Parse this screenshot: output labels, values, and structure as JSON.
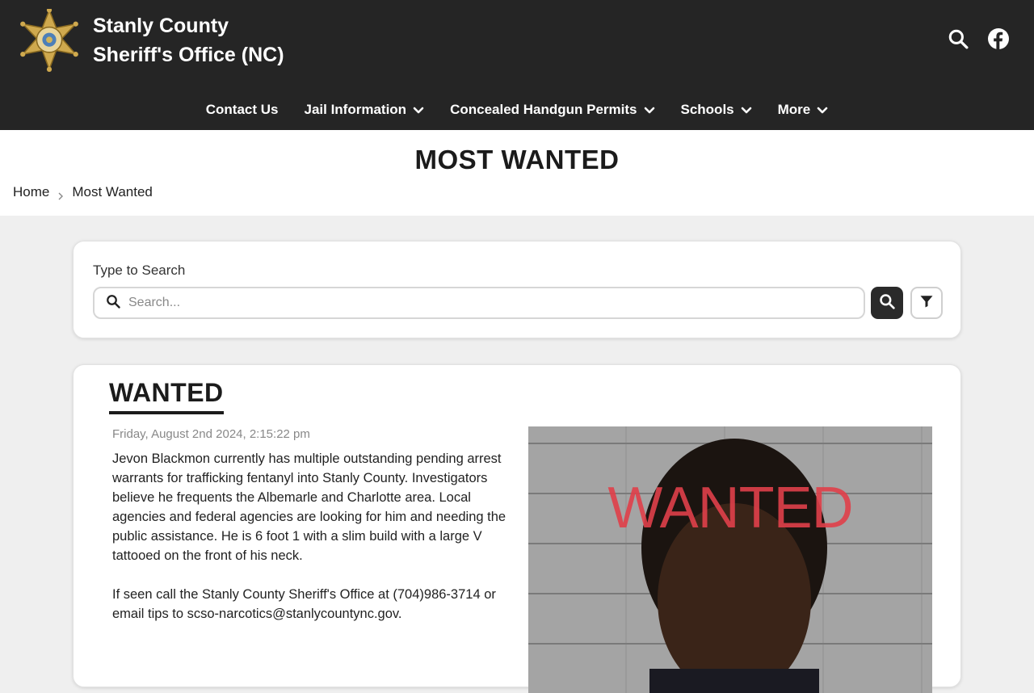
{
  "header": {
    "title_line1": "Stanly County",
    "title_line2": "Sheriff's Office (NC)",
    "badge_text": "SHERIFF STANLY COUNTY"
  },
  "nav": {
    "items": [
      {
        "label": "Contact Us",
        "has_dropdown": false
      },
      {
        "label": "Jail Information",
        "has_dropdown": true
      },
      {
        "label": "Concealed Handgun Permits",
        "has_dropdown": true
      },
      {
        "label": "Schools",
        "has_dropdown": true
      },
      {
        "label": "More",
        "has_dropdown": true
      }
    ]
  },
  "page": {
    "title": "MOST WANTED"
  },
  "breadcrumb": {
    "home": "Home",
    "current": "Most Wanted"
  },
  "search": {
    "label": "Type to Search",
    "placeholder": "Search...",
    "value": ""
  },
  "post": {
    "heading": "WANTED",
    "date": "Friday, August 2nd 2024, 2:15:22 pm",
    "paragraph1": "Jevon Blackmon currently has multiple outstanding pending arrest warrants for trafficking fentanyl into Stanly County. Investigators believe he frequents the Albemarle and Charlotte area. Local agencies and federal agencies are looking for him and needing the public assistance. He is 6 foot 1 with a slim build with a large V tattooed on the front of his neck.",
    "paragraph2": "If seen call the Stanly County Sheriff's Office at (704)986-3714 or email tips to scso-narcotics@stanlycountync.gov.",
    "photo_stamp": "WANTED"
  },
  "icons": {
    "search": "search-icon",
    "facebook": "facebook-icon",
    "chevron": "chevron-down-icon",
    "filter": "filter-icon",
    "breadcrumb_sep": "chevron-right-icon"
  },
  "colors": {
    "header_bg": "#252525",
    "page_bg": "#efefef",
    "stamp_red": "#e0404a"
  }
}
